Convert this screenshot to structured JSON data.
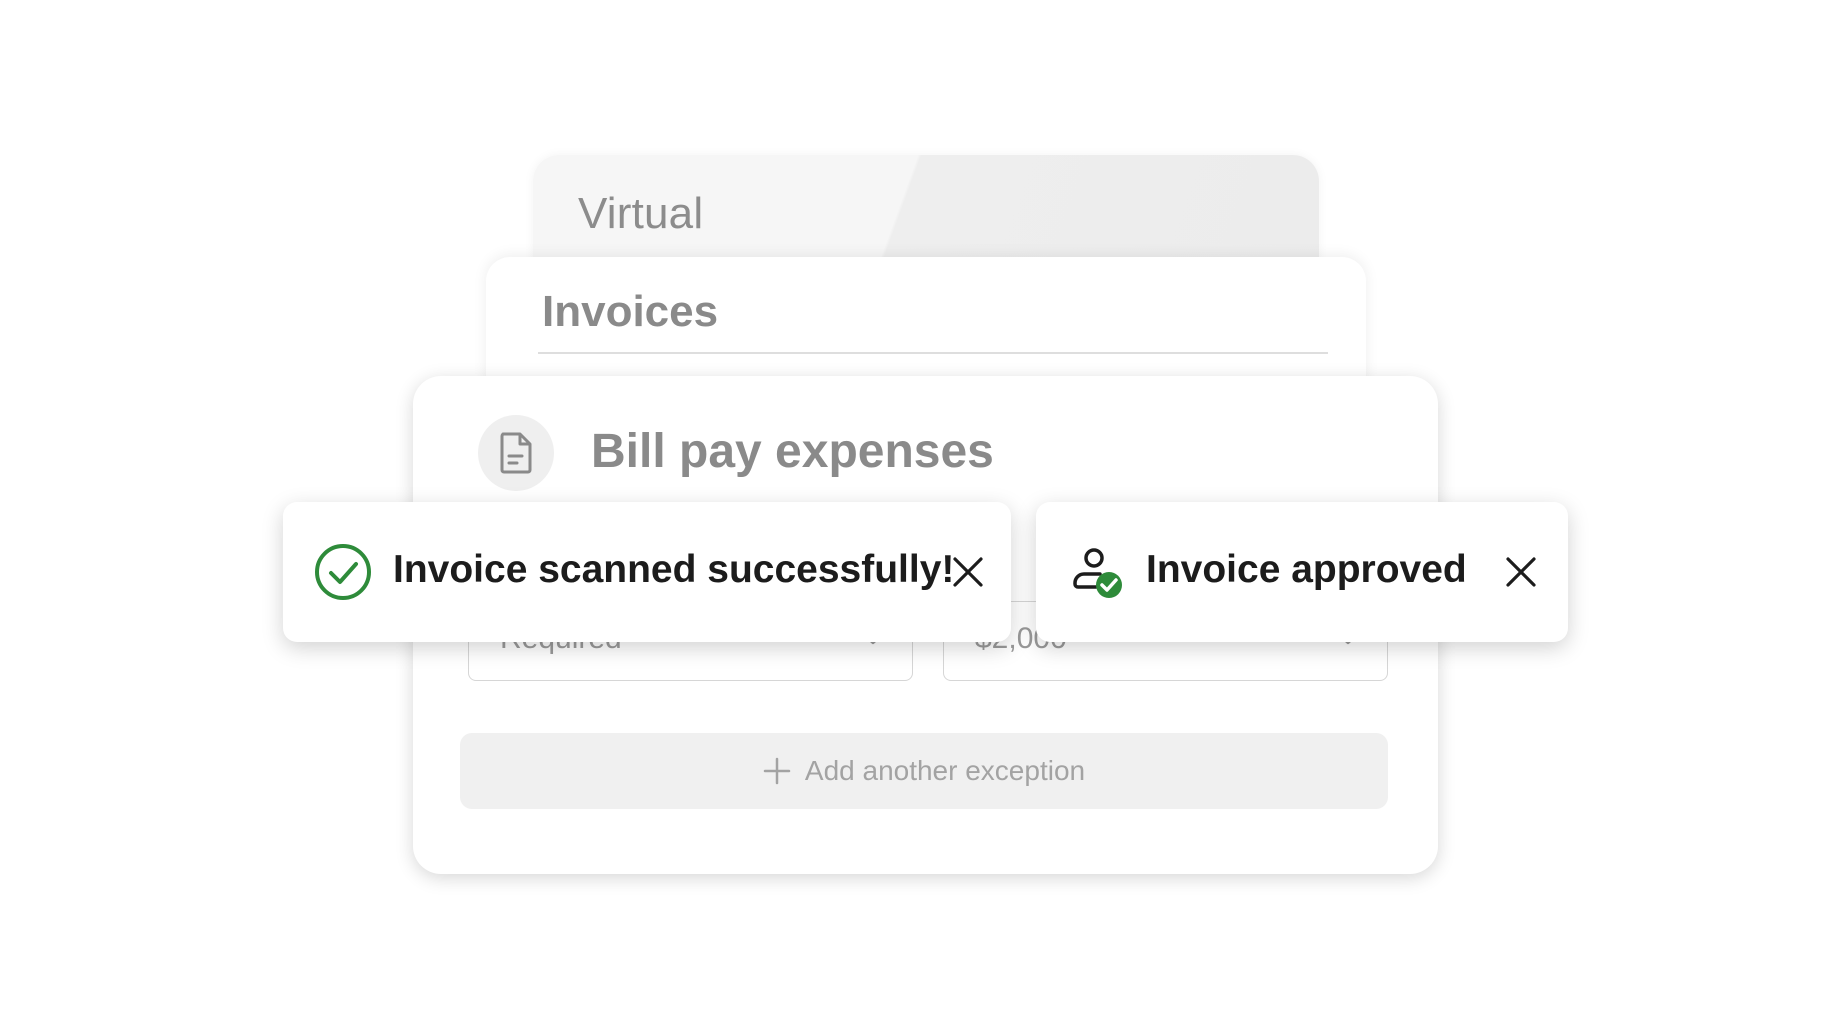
{
  "cards": {
    "virtual": {
      "title": "Virtual"
    },
    "invoices": {
      "title": "Invoices"
    },
    "billpay": {
      "title": "Bill pay expenses",
      "icon": "document-icon",
      "fields": [
        {
          "value": "Required",
          "icon": "chevron-down-icon"
        },
        {
          "value": "$2,000",
          "icon": "chevron-down-icon"
        }
      ],
      "add_button": {
        "label": "Add another exception",
        "icon": "plus-icon"
      }
    }
  },
  "toasts": [
    {
      "message": "Invoice scanned successfully!",
      "icon": "check-circle-icon",
      "close_icon": "close-icon"
    },
    {
      "message": "Invoice approved",
      "icon": "user-approved-icon",
      "close_icon": "close-icon"
    }
  ],
  "colors": {
    "success": "#2e8b3a",
    "muted_text": "#8a8a8a",
    "toast_text": "#1c1c1c"
  }
}
